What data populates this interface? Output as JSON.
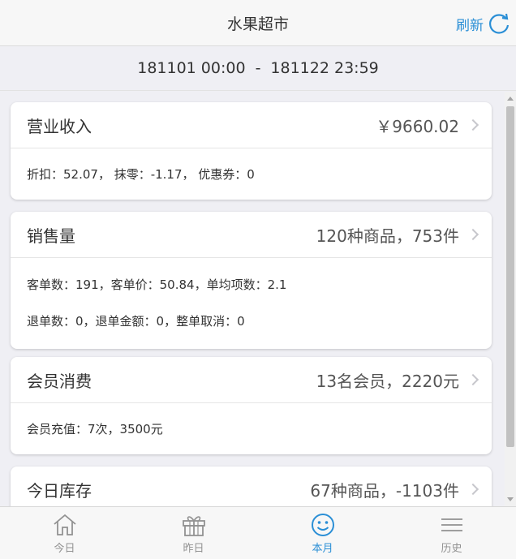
{
  "header": {
    "title": "水果超市",
    "refresh_label": "刷新"
  },
  "date_range": {
    "start": "181101 00:00",
    "separator": "-",
    "end": "181122 23:59"
  },
  "cards": [
    {
      "title": "营业收入",
      "value": "￥9660.02",
      "lines": [
        "折扣：52.07， 抹零：-1.17， 优惠券：0"
      ]
    },
    {
      "title": "销售量",
      "value": "120种商品，753件",
      "lines": [
        "客单数：191，客单价：50.84，单均项数：2.1",
        "退单数：0，退单金额：0，整单取消：0"
      ]
    },
    {
      "title": "会员消费",
      "value": "13名会员，2220元",
      "lines": [
        "会员充值：7次，3500元"
      ]
    },
    {
      "title": "今日库存",
      "value": "67种商品，-1103件",
      "lines": []
    }
  ],
  "tabs": [
    {
      "label": "今日",
      "icon": "home-icon"
    },
    {
      "label": "昨日",
      "icon": "gift-icon"
    },
    {
      "label": "本月",
      "icon": "smiley-icon",
      "active": true
    },
    {
      "label": "历史",
      "icon": "menu-icon"
    }
  ],
  "colors": {
    "accent": "#2b8fd6",
    "inactive": "#929292",
    "background": "#efeff4"
  }
}
